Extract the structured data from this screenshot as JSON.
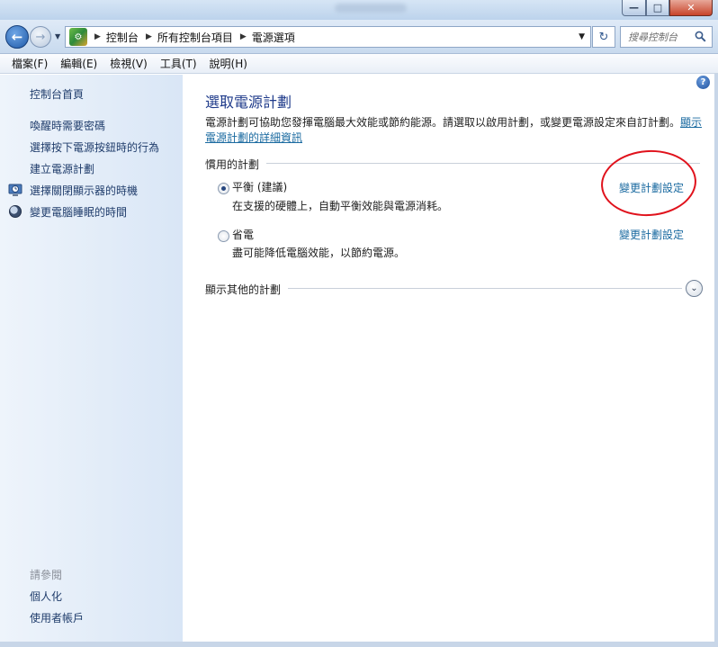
{
  "window": {
    "min_glyph": "—",
    "max_glyph": "□",
    "close_glyph": "✕"
  },
  "nav": {
    "back_glyph": "←",
    "forward_glyph": "→",
    "breadcrumb": [
      "控制台",
      "所有控制台項目",
      "電源選項"
    ],
    "search_placeholder": "搜尋控制台",
    "refresh_glyph": "↻"
  },
  "menu": [
    "檔案(F)",
    "編輯(E)",
    "檢視(V)",
    "工具(T)",
    "說明(H)"
  ],
  "sidebar": {
    "home": "控制台首頁",
    "links": [
      {
        "label": "喚醒時需要密碼",
        "icon": ""
      },
      {
        "label": "選擇按下電源按鈕時的行為",
        "icon": ""
      },
      {
        "label": "建立電源計劃",
        "icon": ""
      },
      {
        "label": "選擇關閉顯示器的時機",
        "icon": "monitor-clock-icon"
      },
      {
        "label": "變更電腦睡眠的時間",
        "icon": "moon-icon"
      }
    ],
    "see_also_header": "請參閱",
    "see_also": [
      "個人化",
      "使用者帳戶"
    ]
  },
  "main": {
    "title": "選取電源計劃",
    "description": "電源計劃可協助您發揮電腦最大效能或節約能源。請選取以啟用計劃，或變更電源設定來自訂計劃。",
    "description_link_a": "顯示",
    "description_link_b": "電源計劃的詳細資訊",
    "preferred_header": "慣用的計劃",
    "plans": [
      {
        "name": "平衡 (建議)",
        "desc": "在支援的硬體上，自動平衡效能與電源消耗。",
        "link": "變更計劃設定",
        "selected": true
      },
      {
        "name": "省電",
        "desc": "盡可能降低電腦效能，以節約電源。",
        "link": "變更計劃設定",
        "selected": false
      }
    ],
    "other_header": "顯示其他的計劃",
    "expand_glyph": "⌄",
    "help_glyph": "?",
    "annotation_color": "#e0121c"
  }
}
